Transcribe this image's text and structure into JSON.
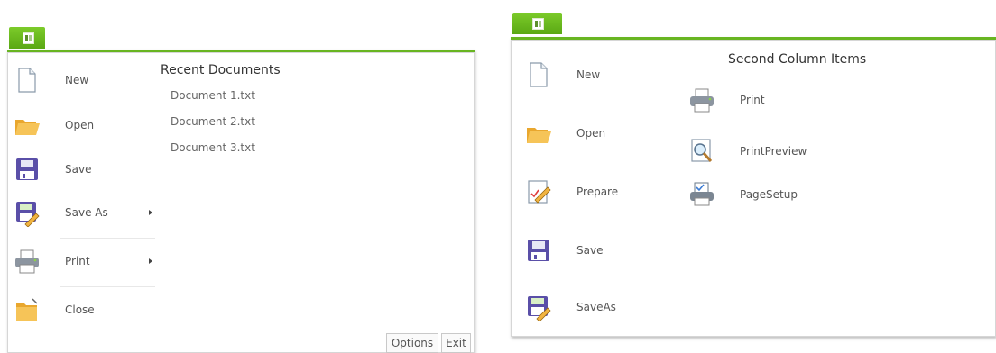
{
  "left_menu": {
    "items": [
      {
        "label": "New",
        "icon": "new-document-icon"
      },
      {
        "label": "Open",
        "icon": "open-folder-icon"
      },
      {
        "label": "Save",
        "icon": "save-icon"
      },
      {
        "label": "Save As",
        "icon": "save-as-icon",
        "has_submenu": true
      },
      {
        "label": "Print",
        "icon": "print-icon",
        "has_submenu": true
      },
      {
        "label": "Close",
        "icon": "close-folder-icon"
      }
    ],
    "recent_title": "Recent Documents",
    "recent_items": [
      "Document 1.txt",
      "Document 2.txt",
      "Document 3.txt"
    ],
    "footer": {
      "options": "Options",
      "exit": "Exit"
    }
  },
  "right_menu": {
    "items": [
      {
        "label": "New",
        "icon": "new-document-icon"
      },
      {
        "label": "Open",
        "icon": "open-folder-icon"
      },
      {
        "label": "Prepare",
        "icon": "prepare-icon"
      },
      {
        "label": "Save",
        "icon": "save-icon"
      },
      {
        "label": "SaveAs",
        "icon": "save-as-icon"
      }
    ],
    "second_column_title": "Second Column Items",
    "second_column_items": [
      {
        "label": "Print",
        "icon": "printer-icon"
      },
      {
        "label": "PrintPreview",
        "icon": "print-preview-icon"
      },
      {
        "label": "PageSetup",
        "icon": "page-setup-icon"
      }
    ]
  },
  "colors": {
    "accent": "#68b521",
    "folder": "#f2b440",
    "disk": "#5a4fa8"
  }
}
